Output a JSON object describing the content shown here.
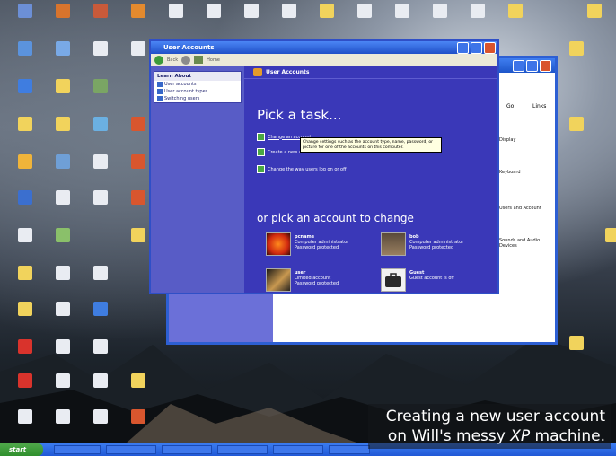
{
  "window": {
    "title": "User Accounts",
    "toolbar": {
      "back": "Back",
      "home": "Home"
    }
  },
  "sidebar": {
    "learn_about": {
      "header": "Learn About",
      "items": [
        "User accounts",
        "User account types",
        "Switching users"
      ]
    }
  },
  "header": {
    "title": "User Accounts"
  },
  "main": {
    "pick_task_heading": "Pick a task...",
    "tasks": [
      "Change an account",
      "Create a new account",
      "Change the way users log on or off"
    ],
    "tooltip": "Change settings such as the account type, name, password, or picture for one of the accounts on this computer.",
    "pick_account_heading": "or pick an account to change",
    "accounts": [
      {
        "name": "pcname",
        "type": "Computer administrator",
        "status": "Password protected"
      },
      {
        "name": "bob",
        "type": "Computer administrator",
        "status": "Password protected"
      },
      {
        "name": "user",
        "type": "Limited account",
        "status": "Password protected"
      },
      {
        "name": "Guest",
        "type": "Guest account is off",
        "status": ""
      }
    ]
  },
  "background_window": {
    "go": "Go",
    "links": "Links",
    "items": [
      "Display",
      "Keyboard",
      "Users and Account",
      "Sounds and Audio Devices"
    ]
  },
  "taskbar": {
    "start": "start"
  },
  "caption": {
    "line1": "Creating a new user account",
    "line2_pre": "on Will's messy ",
    "line2_em": "XP",
    "line2_post": " machine."
  }
}
